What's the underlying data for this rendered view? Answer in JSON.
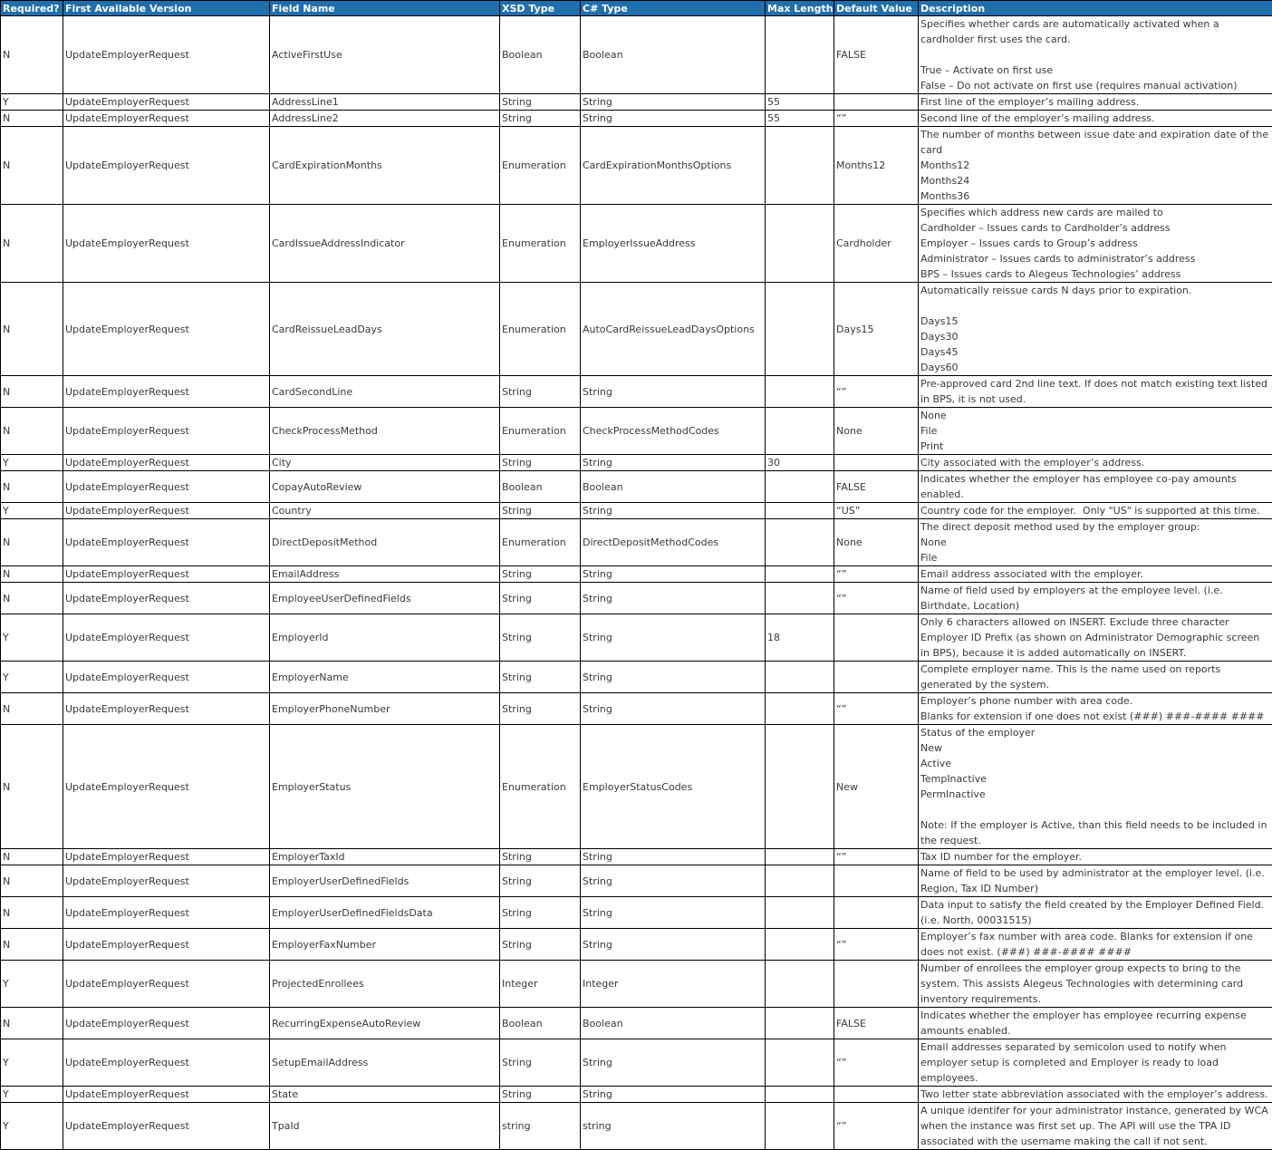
{
  "columns": [
    "Required?",
    "First Available Version",
    "Field Name",
    "XSD Type",
    "C# Type",
    "Max Length",
    "Default Value",
    "Description"
  ],
  "rows": [
    {
      "req": "N",
      "ver": "UpdateEmployerRequest",
      "field": "ActiveFirstUse",
      "xsd": "Boolean",
      "cs": "Boolean",
      "max": "",
      "def": "FALSE",
      "desc": "Specifies whether cards are automatically activated when a cardholder first uses the card.\n\nTrue – Activate on first use\nFalse – Do not activate on first use (requires manual activation)"
    },
    {
      "req": "Y",
      "ver": "UpdateEmployerRequest",
      "field": "AddressLine1",
      "xsd": "String",
      "cs": "String",
      "max": "55",
      "def": "",
      "desc": "First line of the employer’s mailing address."
    },
    {
      "req": "N",
      "ver": "UpdateEmployerRequest",
      "field": "AddressLine2",
      "xsd": "String",
      "cs": "String",
      "max": "55",
      "def": "“”",
      "desc": "Second line of the employer’s mailing address."
    },
    {
      "req": "N",
      "ver": "UpdateEmployerRequest",
      "field": "CardExpirationMonths",
      "xsd": "Enumeration",
      "cs": "CardExpirationMonthsOptions",
      "max": "",
      "def": "Months12",
      "desc": "The number of months between issue date and expiration date of the card\nMonths12\nMonths24\nMonths36"
    },
    {
      "req": "N",
      "ver": "UpdateEmployerRequest",
      "field": "CardIssueAddressIndicator",
      "xsd": "Enumeration",
      "cs": "EmployerIssueAddress",
      "max": "",
      "def": "Cardholder",
      "desc": "Specifies which address new cards are mailed to\nCardholder – Issues cards to Cardholder’s address\nEmployer – Issues cards to Group’s address\nAdministrator – Issues cards to administrator’s address\nBPS – Issues cards to Alegeus Technologies’ address"
    },
    {
      "req": "N",
      "ver": "UpdateEmployerRequest",
      "field": "CardReissueLeadDays",
      "xsd": "Enumeration",
      "cs": "AutoCardReissueLeadDaysOptions",
      "max": "",
      "def": "Days15",
      "desc": "Automatically reissue cards N days prior to expiration.\n\nDays15\nDays30\nDays45\nDays60"
    },
    {
      "req": "N",
      "ver": "UpdateEmployerRequest",
      "field": "CardSecondLine",
      "xsd": "String",
      "cs": "String",
      "max": "",
      "def": "“”",
      "desc": "Pre-approved card 2nd line text. If does not match existing text listed in BPS, it is not used."
    },
    {
      "req": "N",
      "ver": "UpdateEmployerRequest",
      "field": "CheckProcessMethod",
      "xsd": "Enumeration",
      "cs": "CheckProcessMethodCodes",
      "max": "",
      "def": "None",
      "desc": "None\nFile\nPrint"
    },
    {
      "req": "Y",
      "ver": "UpdateEmployerRequest",
      "field": "City",
      "xsd": "String",
      "cs": "String",
      "max": "30",
      "def": "",
      "desc": "City associated with the employer’s address."
    },
    {
      "req": "N",
      "ver": "UpdateEmployerRequest",
      "field": "CopayAutoReview",
      "xsd": "Boolean",
      "cs": "Boolean",
      "max": "",
      "def": "FALSE",
      "desc": "Indicates whether the employer has employee co-pay amounts enabled."
    },
    {
      "req": "Y",
      "ver": "UpdateEmployerRequest",
      "field": "Country",
      "xsd": "String",
      "cs": "String",
      "max": "",
      "def": "“US”",
      "desc": "Country code for the employer.  Only \"US\" is supported at this time."
    },
    {
      "req": "N",
      "ver": "UpdateEmployerRequest",
      "field": "DirectDepositMethod",
      "xsd": "Enumeration",
      "cs": "DirectDepositMethodCodes",
      "max": "",
      "def": "None",
      "desc": "The direct deposit method used by the employer group:\nNone\nFile"
    },
    {
      "req": "N",
      "ver": "UpdateEmployerRequest",
      "field": "EmailAddress",
      "xsd": "String",
      "cs": "String",
      "max": "",
      "def": "“”",
      "desc": "Email address associated with the employer."
    },
    {
      "req": "N",
      "ver": "UpdateEmployerRequest",
      "field": "EmployeeUserDefinedFields",
      "xsd": "String",
      "cs": "String",
      "max": "",
      "def": "“”",
      "desc": "Name of field used by employers at the employee level. (i.e. Birthdate, Location)"
    },
    {
      "req": "Y",
      "ver": "UpdateEmployerRequest",
      "field": "EmployerId",
      "xsd": "String",
      "cs": "String",
      "max": "18",
      "def": "",
      "desc": "Only 6 characters allowed on INSERT. Exclude three character Employer ID Prefix (as shown on Administrator Demographic screen in BPS), because it is added automatically on INSERT."
    },
    {
      "req": "Y",
      "ver": "UpdateEmployerRequest",
      "field": "EmployerName",
      "xsd": "String",
      "cs": "String",
      "max": "",
      "def": "",
      "desc": "Complete employer name. This is the name used on reports generated by the system."
    },
    {
      "req": "N",
      "ver": "UpdateEmployerRequest",
      "field": "EmployerPhoneNumber",
      "xsd": "String",
      "cs": "String",
      "max": "",
      "def": "“”",
      "desc": "Employer’s phone number with area code.\nBlanks for extension if one does not exist (###) ###-#### ####"
    },
    {
      "req": "N",
      "ver": "UpdateEmployerRequest",
      "field": "EmployerStatus",
      "xsd": "Enumeration",
      "cs": "EmployerStatusCodes",
      "max": "",
      "def": "New",
      "desc": "Status of the employer\nNew\nActive\nTempInactive\nPermInactive\n\nNote: If the employer is Active, than this field needs to be included in the request."
    },
    {
      "req": "N",
      "ver": "UpdateEmployerRequest",
      "field": "EmployerTaxId",
      "xsd": "String",
      "cs": "String",
      "max": "",
      "def": "“”",
      "desc": "Tax ID number for the employer."
    },
    {
      "req": "N",
      "ver": "UpdateEmployerRequest",
      "field": "EmployerUserDefinedFields",
      "xsd": "String",
      "cs": "String",
      "max": "",
      "def": "",
      "desc": "Name of field to be used by administrator at the employer level. (i.e. Region, Tax ID Number)"
    },
    {
      "req": "N",
      "ver": "UpdateEmployerRequest",
      "field": "EmployerUserDefinedFieldsData",
      "xsd": "String",
      "cs": "String",
      "max": "",
      "def": "",
      "desc": "Data input to satisfy the field created by the Employer Defined Field. (i.e. North, 00031515)"
    },
    {
      "req": "N",
      "ver": "UpdateEmployerRequest",
      "field": "EmployerFaxNumber",
      "xsd": "String",
      "cs": "String",
      "max": "",
      "def": "“”",
      "desc": "Employer’s fax number with area code. Blanks for extension if one does not exist. (###) ###-#### ####"
    },
    {
      "req": "Y",
      "ver": "UpdateEmployerRequest",
      "field": "ProjectedEnrollees",
      "xsd": "Integer",
      "cs": "Integer",
      "max": "",
      "def": "",
      "desc": "Number of enrollees the employer group expects to bring to the system. This assists Alegeus Technologies with determining card inventory requirements."
    },
    {
      "req": "N",
      "ver": "UpdateEmployerRequest",
      "field": "RecurringExpenseAutoReview",
      "xsd": "Boolean",
      "cs": "Boolean",
      "max": "",
      "def": "FALSE",
      "desc": "Indicates whether the employer has employee recurring expense amounts enabled."
    },
    {
      "req": "Y",
      "ver": "UpdateEmployerRequest",
      "field": "SetupEmailAddress",
      "xsd": "String",
      "cs": "String",
      "max": "",
      "def": "“”",
      "desc": "Email addresses separated by semicolon used to notify when employer setup is completed and Employer is ready to load employees."
    },
    {
      "req": "Y",
      "ver": "UpdateEmployerRequest",
      "field": "State",
      "xsd": "String",
      "cs": "String",
      "max": "",
      "def": "",
      "desc": "Two letter state abbreviation associated with the employer’s address."
    },
    {
      "req": "Y",
      "ver": "UpdateEmployerRequest",
      "field": "TpaId",
      "xsd": "string",
      "cs": "string",
      "max": "",
      "def": "“”",
      "desc": "A unique identifer for your administrator instance, generated by WCA when the instance was first set up. The API will use the TPA ID associated with the username making the call if not sent."
    }
  ]
}
